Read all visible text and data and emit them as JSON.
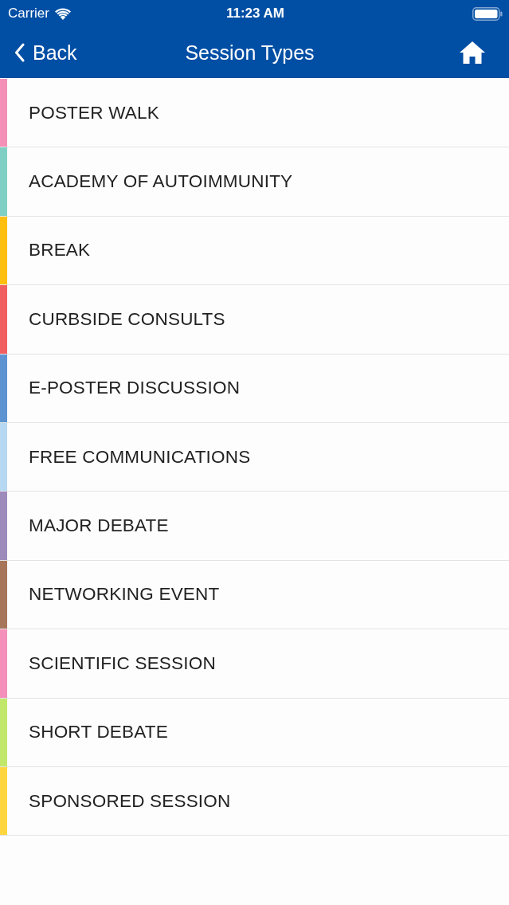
{
  "status_bar": {
    "carrier": "Carrier",
    "time": "11:23 AM"
  },
  "nav_bar": {
    "back_label": "Back",
    "title": "Session Types"
  },
  "session_types": [
    {
      "label": "POSTER WALK",
      "color": "#f48fb8"
    },
    {
      "label": "ACADEMY OF AUTOIMMUNITY",
      "color": "#7fcfc4"
    },
    {
      "label": "BREAK",
      "color": "#ffbf10"
    },
    {
      "label": "CURBSIDE CONSULTS",
      "color": "#f25f61"
    },
    {
      "label": "E-POSTER DISCUSSION",
      "color": "#5d93d1"
    },
    {
      "label": "FREE COMMUNICATIONS",
      "color": "#b6d8f0"
    },
    {
      "label": "MAJOR DEBATE",
      "color": "#9d8bbb"
    },
    {
      "label": "NETWORKING EVENT",
      "color": "#a6755a"
    },
    {
      "label": "SCIENTIFIC SESSION",
      "color": "#f590ba"
    },
    {
      "label": "SHORT DEBATE",
      "color": "#c1e86b"
    },
    {
      "label": "SPONSORED SESSION",
      "color": "#ffd640"
    }
  ]
}
